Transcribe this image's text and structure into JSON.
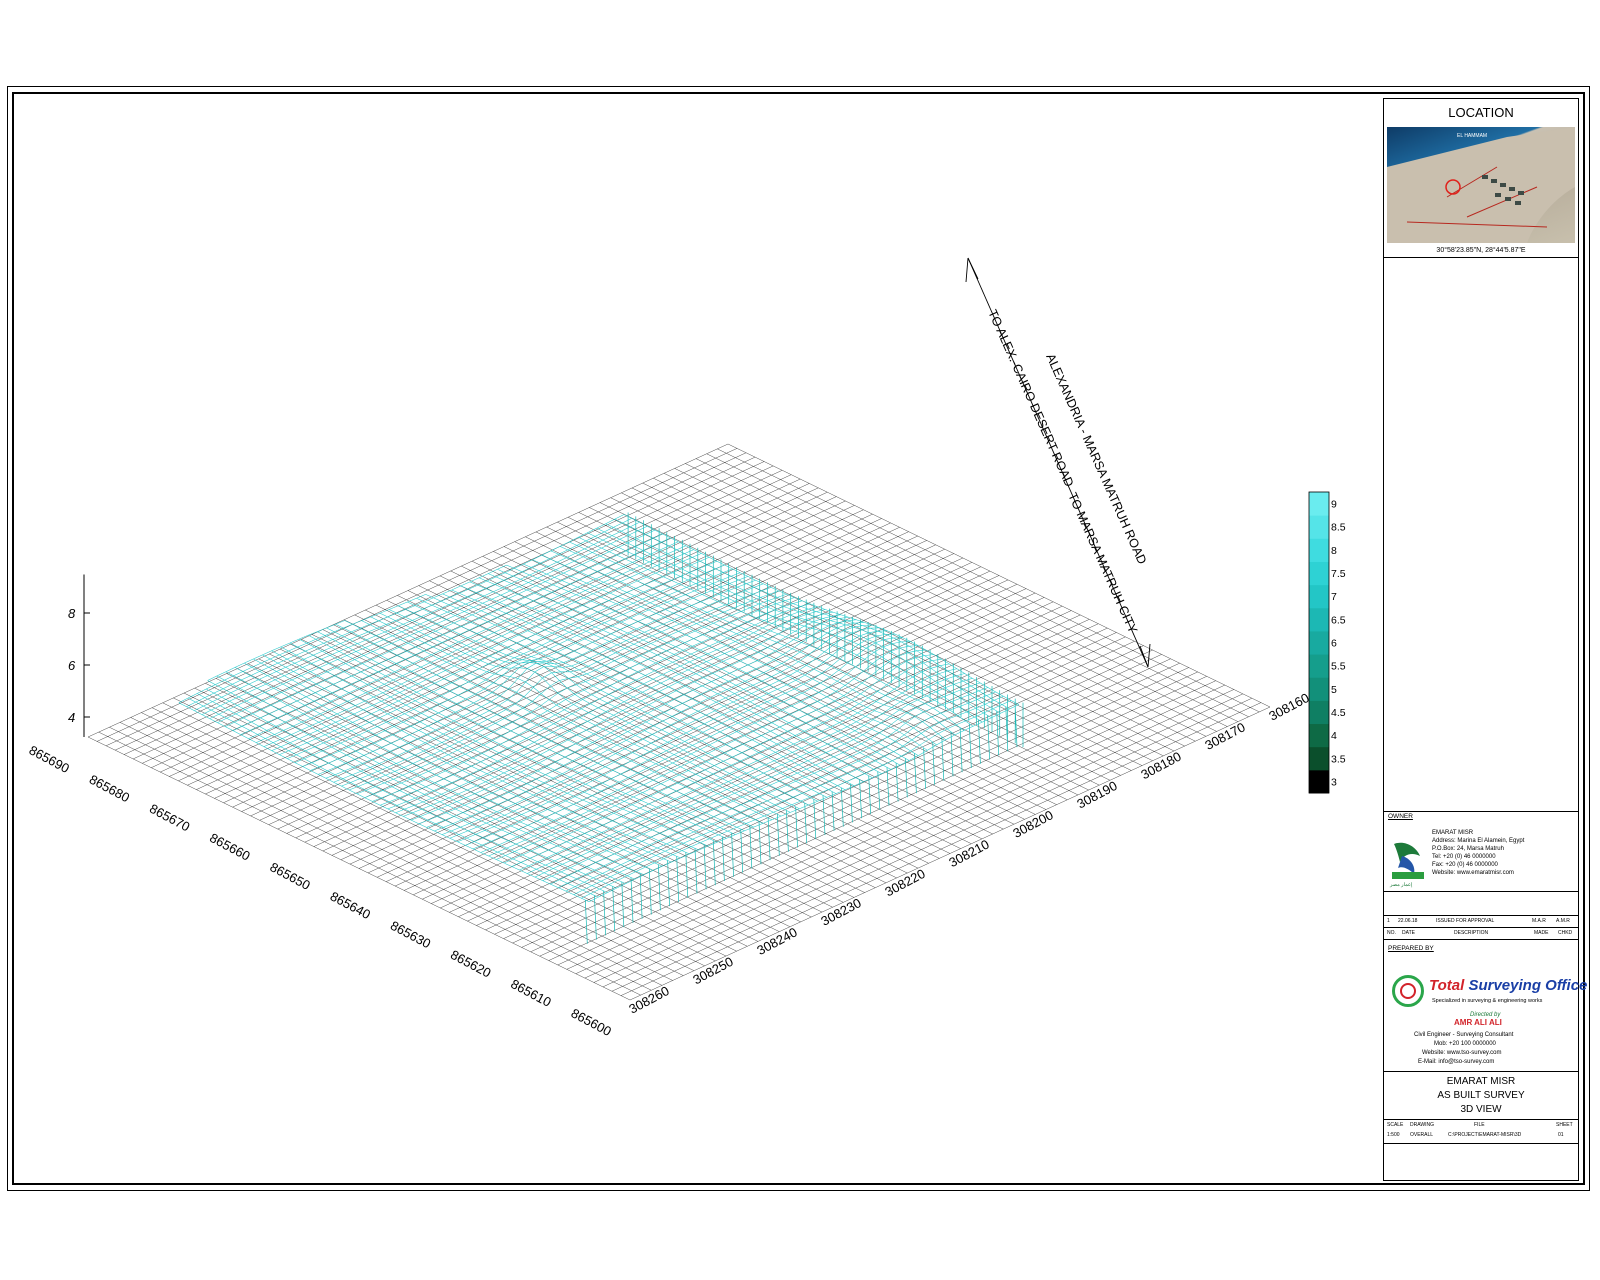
{
  "chart_data": {
    "type": "surface",
    "title": "",
    "x_label": "",
    "y_label": "",
    "z_label": "",
    "x_ticks": [
      308260,
      308250,
      308240,
      308230,
      308220,
      308210,
      308200,
      308190,
      308180,
      308170,
      308160
    ],
    "x_tick_labels": [
      "308260",
      "308250",
      "308240",
      "308230",
      "308220",
      "308210",
      "308200",
      "308190",
      "308180",
      "308170",
      "308160"
    ],
    "y_ticks": [
      865600,
      865610,
      865620,
      865630,
      865640,
      865650,
      865660,
      865670,
      865680,
      865690
    ],
    "y_tick_labels": [
      "865600",
      "865610",
      "865620",
      "865630",
      "865640",
      "865650",
      "865660",
      "865670",
      "865680",
      "865690"
    ],
    "z_ticks": [
      4,
      6,
      8
    ],
    "z_tick_labels": [
      "4",
      "6",
      "8"
    ],
    "zlim": [
      3,
      9.5
    ],
    "color_scale": {
      "ticks": [
        "3",
        "3.5",
        "4",
        "4.5",
        "5",
        "5.5",
        "6",
        "6.5",
        "7",
        "7.5",
        "8",
        "8.5",
        "9"
      ],
      "colors": [
        "#000000",
        "#0b4f2c",
        "#0e6a45",
        "#0f7f63",
        "#12907a",
        "#159e8c",
        "#18aaa0",
        "#1cb8b4",
        "#23c6c6",
        "#2ed2d4",
        "#3fdce0",
        "#55e4e8",
        "#6aecef"
      ]
    },
    "surface_description_levels": {
      "plateau_elevation": 7.5,
      "peak_elevation": 9.2,
      "base_elevation": 3
    }
  },
  "annotations": {
    "road_main": "ALEXANDRIA  -  MARSA  MATRUH  ROAD",
    "to_alex": "TO  ALEX.-CAIRO  DESERT  ROAD",
    "to_marsa": "TO  MARSA  MATRUH  CITY"
  },
  "title_block": {
    "location_title": "LOCATION",
    "map_label": "EL HAMMAM",
    "coords": "30°58'23.85\"N,  28°44'5.87\"E",
    "owner_label": "OWNER",
    "owner_lines": [
      "EMARAT MISR",
      "Address: Marina El Alamein, Egypt",
      "P.O.Box: 24, Marsa Matruh",
      "Tel: +20 (0) 46 0000000",
      "Fax: +20 (0) 46 0000000",
      "Website: www.emaratmisr.com"
    ],
    "owner_logo_text": "إعمار مصر",
    "revision": {
      "row1": [
        "1",
        "22.06.18",
        "ISSUED FOR APPROVAL",
        "M.A.R",
        "A.M.R"
      ],
      "header": [
        "NO.",
        "DATE",
        "DESCRIPTION",
        "MADE",
        "CHKD"
      ]
    },
    "prepared_label": "PREPARED BY",
    "tso_name_red": "Total ",
    "tso_name_blue": "Surveying Office",
    "tso_sub": "Specialized in surveying & engineering works",
    "tso_directed": "Directed by",
    "tso_person": "AMR ALI ALI",
    "tso_lines": [
      "Civil Engineer - Surveying Consultant",
      "Mob: +20 100 0000000",
      "Website: www.tso-survey.com",
      "E-Mail: info@tso-survey.com"
    ],
    "project": [
      "EMARAT  MISR",
      "AS  BUILT  SURVEY",
      "3D  VIEW"
    ],
    "meta_head": [
      "SCALE",
      "DRAWING",
      "FILE",
      "SHEET"
    ],
    "meta_vals": [
      "1:500",
      "OVERALL",
      "C:\\PROJECT\\EMARAT-MISR\\3D",
      "01"
    ]
  }
}
